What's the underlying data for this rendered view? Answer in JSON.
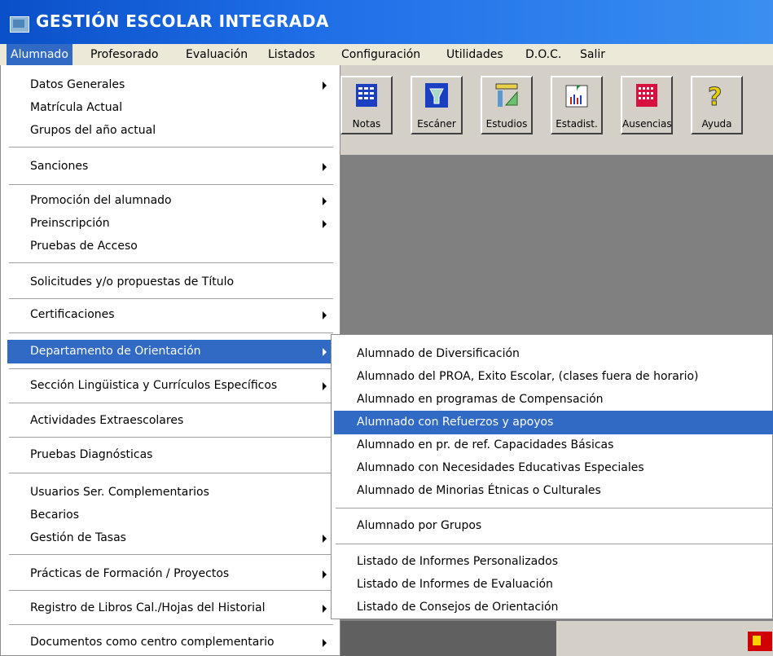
{
  "window": {
    "title": "GESTIÓN ESCOLAR INTEGRADA"
  },
  "menubar": [
    "Alumnado",
    "Profesorado",
    "Evaluación",
    "Listados",
    "Configuración",
    "Utilidades",
    "D.O.C.",
    "Salir"
  ],
  "toolbar": {
    "buttons": [
      "Notas",
      "Escáner",
      "Estudios",
      "Estadist.",
      "Ausencias",
      "Ayuda"
    ]
  },
  "menu_alumnado": {
    "items": [
      {
        "label": "Datos Generales",
        "submenu": true
      },
      {
        "label": "Matrícula Actual",
        "submenu": false
      },
      {
        "label": "Grupos del año actual",
        "submenu": false
      },
      {
        "label": "Sanciones",
        "submenu": true
      },
      {
        "label": "Promoción del alumnado",
        "submenu": true
      },
      {
        "label": "Preinscripción",
        "submenu": true
      },
      {
        "label": "Pruebas de Acceso",
        "submenu": false
      },
      {
        "label": "Solicitudes y/o propuestas de Título",
        "submenu": false
      },
      {
        "label": "Certificaciones",
        "submenu": true
      },
      {
        "label": "Departamento de Orientación",
        "submenu": true,
        "highlighted": true
      },
      {
        "label": "Sección Lingüistica y Currículos Específicos",
        "submenu": true
      },
      {
        "label": "Actividades Extraescolares",
        "submenu": false
      },
      {
        "label": "Pruebas Diagnósticas",
        "submenu": false
      },
      {
        "label": "Usuarios Ser. Complementarios",
        "submenu": false
      },
      {
        "label": "Becarios",
        "submenu": false
      },
      {
        "label": "Gestión de Tasas",
        "submenu": true
      },
      {
        "label": "Prácticas de Formación / Proyectos",
        "submenu": true
      },
      {
        "label": "Registro de Libros Cal./Hojas del Historial",
        "submenu": true
      },
      {
        "label": "Documentos como centro complementario",
        "submenu": true
      }
    ]
  },
  "menu_orientacion": {
    "items": [
      {
        "label": "Alumnado de Diversificación"
      },
      {
        "label": "Alumnado del PROA, Exito Escolar, (clases fuera de horario)"
      },
      {
        "label": "Alumnado en programas de Compensación"
      },
      {
        "label": "Alumnado con Refuerzos y apoyos",
        "highlighted": true
      },
      {
        "label": "Alumnado en pr. de ref. Capacidades Básicas"
      },
      {
        "label": "Alumnado con Necesidades Educativas Especiales"
      },
      {
        "label": "Alumnado de Minorias Étnicas o Culturales"
      },
      {
        "label": "Alumnado por Grupos"
      },
      {
        "label": "Listado de Informes Personalizados"
      },
      {
        "label": "Listado de Informes de Evaluación"
      },
      {
        "label": "Listado de Consejos de Orientación"
      }
    ]
  },
  "colors": {
    "highlight": "#316ac5",
    "titlebar": "#1e6ee8",
    "menubar": "#ece9d8"
  }
}
